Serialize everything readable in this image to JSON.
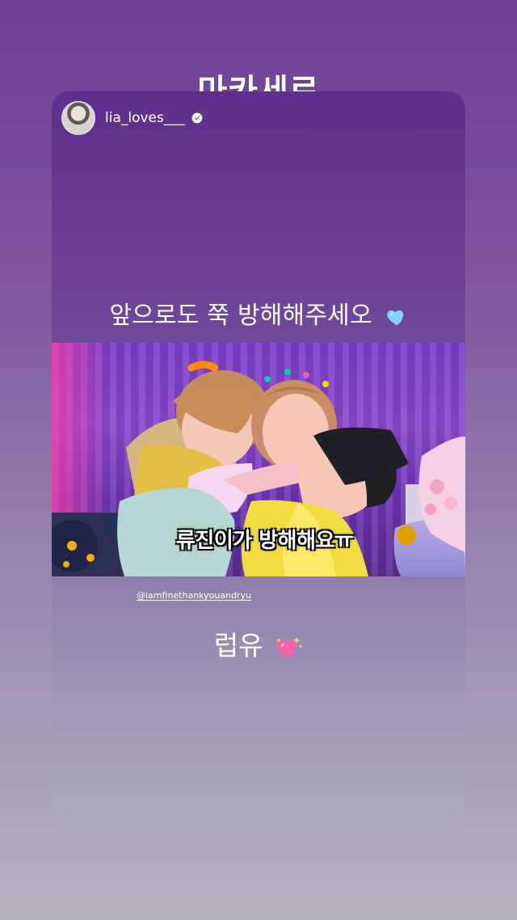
{
  "header": {
    "title": "마카세로"
  },
  "story": {
    "username": "lia_loves___",
    "top_text": "앞으로도 쭉 방해해주세오",
    "video_caption": "류진이가 방해해요ㅠ",
    "mention": "@iamfinethankyouandryu",
    "bottom_text": "럽유"
  },
  "icons": {
    "verified": "verified-check-icon",
    "blue_heart": "blue-heart-icon",
    "sparkling_heart": "sparkling-heart-icon"
  },
  "colors": {
    "top_background": "#6f3f98",
    "bottom_background": "#b7b2bf",
    "card_top": "#5e2f8d",
    "heart_blue": "#7fd3ff",
    "heart_pink": "#ff5fa8"
  }
}
